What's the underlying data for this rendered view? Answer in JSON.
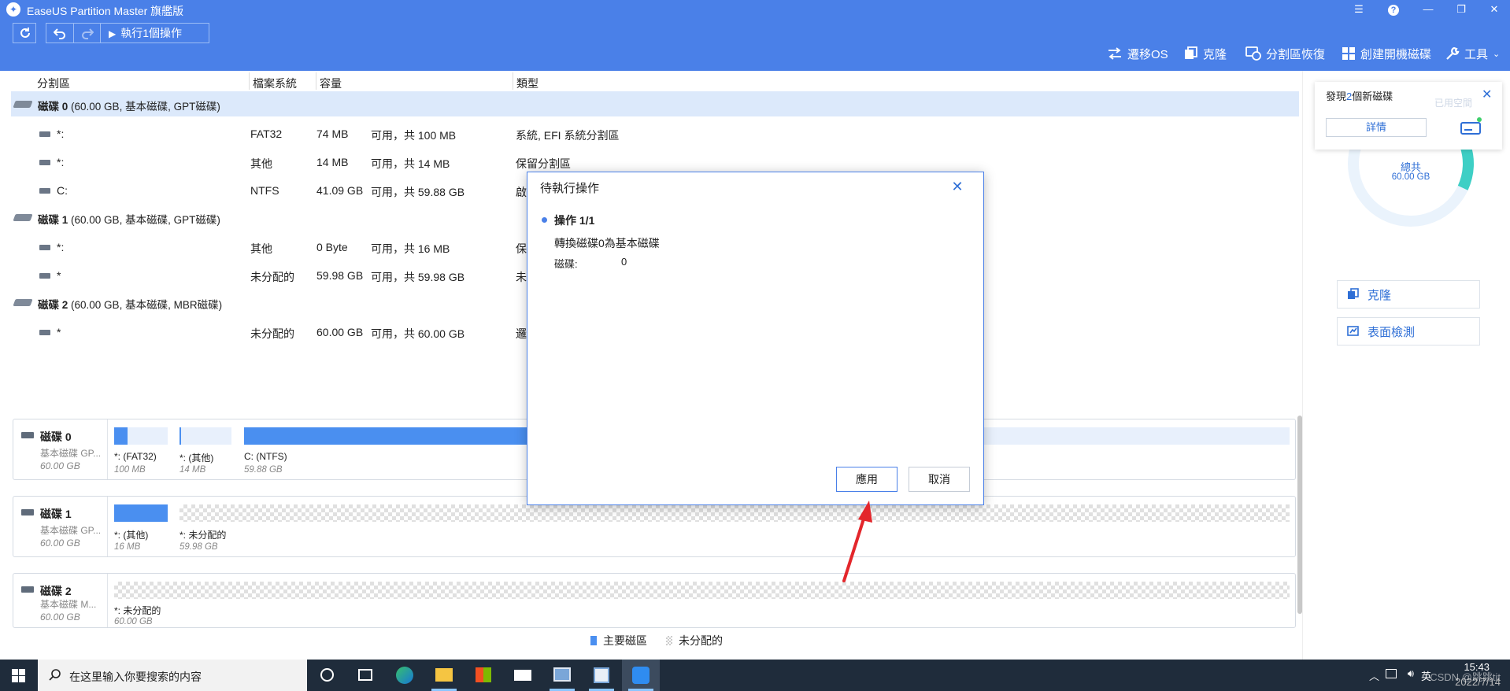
{
  "window": {
    "title": "EaseUS Partition Master 旗艦版"
  },
  "toolbar": {
    "execute_label": "執行1個操作",
    "tools": [
      {
        "label": "遷移OS",
        "icon": "migrate-icon"
      },
      {
        "label": "克隆",
        "icon": "clone-icon"
      },
      {
        "label": "分割區恢復",
        "icon": "recovery-icon"
      },
      {
        "label": "創建開機磁碟",
        "icon": "windows-icon"
      },
      {
        "label": "工具",
        "icon": "wrench-icon"
      }
    ]
  },
  "table": {
    "headers": [
      "分割區",
      "檔案系統",
      "容量",
      "類型"
    ],
    "disks": [
      {
        "name": "磁碟 0",
        "info": "(60.00 GB, 基本磁碟, GPT磁碟)",
        "selected": true,
        "partitions": [
          {
            "name": "*:",
            "fs": "FAT32",
            "used": "74 MB",
            "cap": "可用，共 100 MB",
            "type": "系統, EFI 系統分割區"
          },
          {
            "name": "*:",
            "fs": "其他",
            "used": "14 MB",
            "cap": "可用，共 14 MB",
            "type": "保留分割區"
          },
          {
            "name": "C:",
            "fs": "NTFS",
            "used": "41.09 GB",
            "cap": "可用，共 59.88 GB",
            "type": "啟"
          }
        ]
      },
      {
        "name": "磁碟 1",
        "info": "(60.00 GB, 基本磁碟, GPT磁碟)",
        "selected": false,
        "partitions": [
          {
            "name": "*:",
            "fs": "其他",
            "used": "0 Byte",
            "cap": "可用，共 16 MB",
            "type": "保"
          },
          {
            "name": "*",
            "fs": "未分配的",
            "used": "59.98 GB",
            "cap": "可用，共 59.98 GB",
            "type": "未"
          }
        ]
      },
      {
        "name": "磁碟 2",
        "info": "(60.00 GB, 基本磁碟, MBR磁碟)",
        "selected": false,
        "partitions": [
          {
            "name": "*",
            "fs": "未分配的",
            "used": "60.00 GB",
            "cap": "可用，共 60.00 GB",
            "type": "邏"
          }
        ]
      }
    ]
  },
  "diskmap": [
    {
      "title": "磁碟 0",
      "sub": "基本磁碟 GP...",
      "size": "60.00 GB",
      "segments": [
        {
          "label": "*: (FAT32)",
          "size": "100 MB",
          "style": "blue",
          "fill": 0.25
        },
        {
          "label": "*: (其他)",
          "size": "14 MB",
          "style": "lblue",
          "fill": 0.02
        },
        {
          "label": "C: (NTFS)",
          "size": "59.88 GB",
          "style": "blue",
          "fill": 0.69
        }
      ]
    },
    {
      "title": "磁碟 1",
      "sub": "基本磁碟 GP...",
      "size": "60.00 GB",
      "segments": [
        {
          "label": "*: (其他)",
          "size": "16 MB",
          "style": "blue",
          "fill": 1
        },
        {
          "label": "*: 未分配的",
          "size": "59.98 GB",
          "style": "hatch",
          "fill": 0
        }
      ]
    },
    {
      "title": "磁碟 2",
      "sub": "基本磁碟 M...",
      "size": "60.00 GB",
      "segments": [
        {
          "label": "*: 未分配的",
          "size": "60.00 GB",
          "style": "hatch",
          "fill": 0
        }
      ]
    }
  ],
  "legend": [
    {
      "label": "主要磁區",
      "color": "#4a8ff0"
    },
    {
      "label": "未分配的",
      "color": "#e0e0e0"
    }
  ],
  "right_panel": {
    "notification": {
      "text_before": "發現",
      "count": "2",
      "text_after": "個新磁碟",
      "details_label": "詳情",
      "faded_text": "已用空間"
    },
    "ring": {
      "label": "總共",
      "size": "60.00 GB",
      "used_fraction": 0.69
    },
    "actions": [
      {
        "label": "克隆",
        "icon": "clone-icon"
      },
      {
        "label": "表面檢測",
        "icon": "surface-test-icon"
      }
    ]
  },
  "dialog": {
    "title": "待執行操作",
    "op_heading": "操作 1/1",
    "op_description": "轉換磁碟0為基本磁碟",
    "disk_label": "磁碟:",
    "disk_value": "0",
    "apply_label": "應用",
    "cancel_label": "取消"
  },
  "taskbar": {
    "search_placeholder": "在这里输入你要搜索的内容",
    "time": "15:43",
    "date": "2022/7/14",
    "ime": "英",
    "watermark": "CSDN @跳跳tit"
  },
  "colors": {
    "accent": "#4a80e8",
    "segment_blue": "#4a8ff0",
    "ring_teal": "#3ecfc5",
    "taskbar": "#1f2c3b"
  }
}
